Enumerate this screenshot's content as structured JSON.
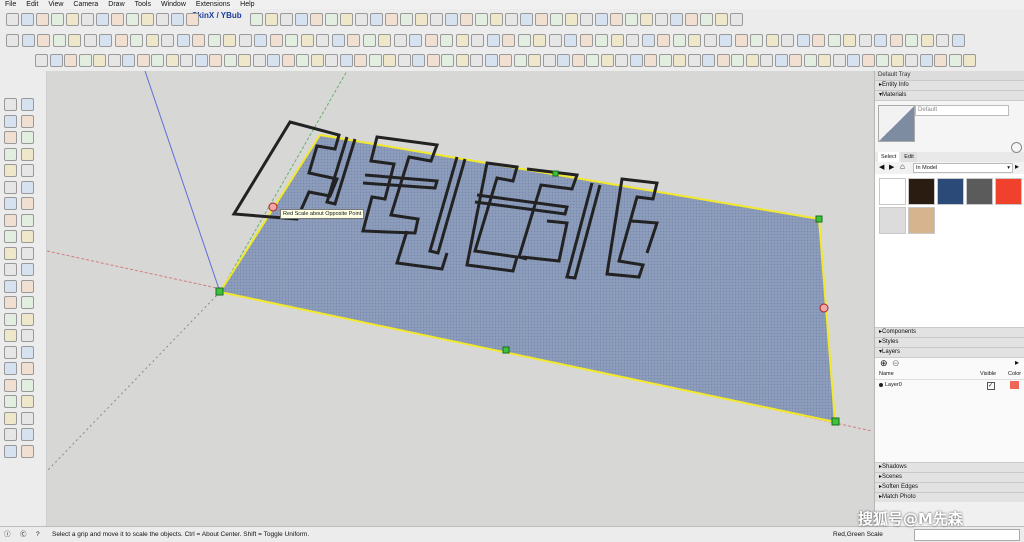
{
  "menu": [
    "File",
    "Edit",
    "View",
    "Camera",
    "Draw",
    "Tools",
    "Window",
    "Extensions",
    "Help"
  ],
  "toolbar": {
    "plugin_label": "SkinX / YBub"
  },
  "viewport": {
    "tooltip": "Red Scale about Opposite Point"
  },
  "tray": {
    "title": "Default Tray",
    "sections_top": [
      {
        "label": "Entity Info",
        "open": false
      },
      {
        "label": "Materials",
        "open": true
      }
    ],
    "materials": {
      "current_name": "Default",
      "tabs": [
        "Select",
        "Edit"
      ],
      "collection": "In Model",
      "swatch_colors": [
        "#ffffff",
        "#2a1c10",
        "#2c4a78",
        "#5b5b5b",
        "#f0412c",
        "#dcdcdc",
        "#d6b48d"
      ]
    },
    "sections_mid": [
      {
        "label": "Components",
        "open": false
      },
      {
        "label": "Styles",
        "open": false
      },
      {
        "label": "Layers",
        "open": true
      }
    ],
    "layers": {
      "headers": {
        "name": "Name",
        "visible": "Visible",
        "color": "Color"
      },
      "rows": [
        {
          "name": "Layer0",
          "visible": true,
          "color": "#ee6655"
        }
      ]
    },
    "sections_bottom": [
      {
        "label": "Shadows",
        "open": false
      },
      {
        "label": "Scenes",
        "open": false
      },
      {
        "label": "Soften Edges",
        "open": false
      },
      {
        "label": "Match Photo",
        "open": false
      }
    ]
  },
  "status": {
    "hint": "Select a grip and move it to scale the objects. Ctrl = About Center. Shift = Toggle Uniform.",
    "scale_axes": "Red,Green Scale"
  },
  "watermark": "搜狐号@M先森"
}
